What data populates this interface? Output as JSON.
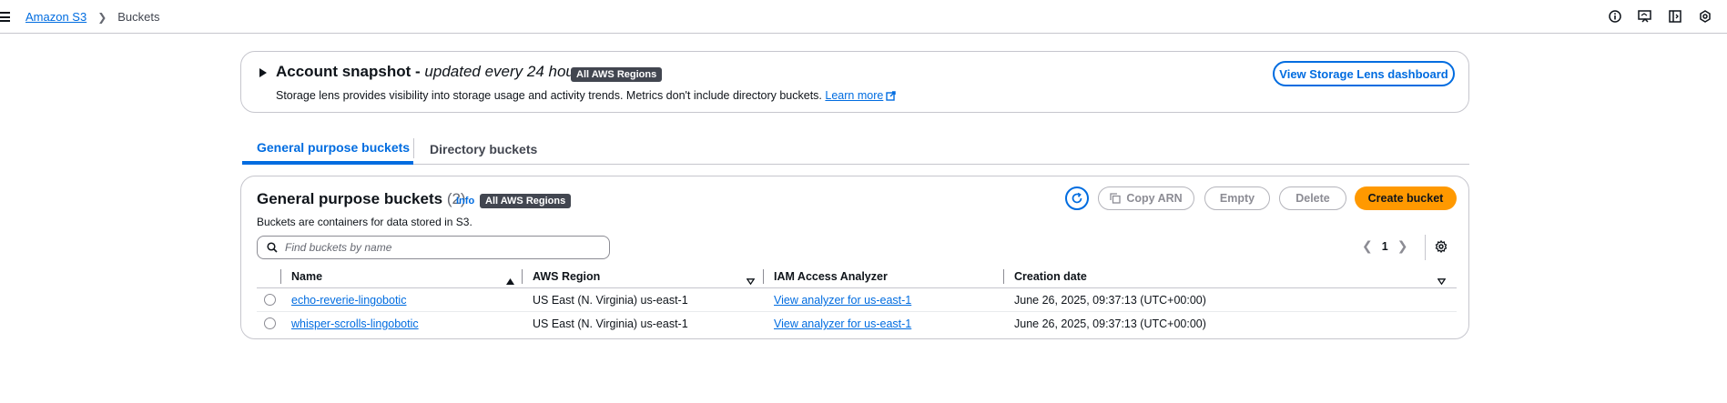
{
  "breadcrumb": {
    "root": "Amazon S3",
    "current": "Buckets"
  },
  "top_icons": [
    "info-icon",
    "feedback-icon",
    "panel-icon",
    "settings-gear-icon"
  ],
  "snapshot": {
    "title_bold": "Account snapshot - ",
    "title_italic": "updated every 24 hours",
    "badge": "All AWS Regions",
    "description": "Storage lens provides visibility into storage usage and activity trends. Metrics don't include directory buckets.",
    "learn_more": "Learn more",
    "lens_button": "View Storage Lens dashboard"
  },
  "tabs": [
    {
      "label": "General purpose buckets",
      "active": true
    },
    {
      "label": "Directory buckets",
      "active": false
    }
  ],
  "panel": {
    "title": "General purpose buckets",
    "count": "(2)",
    "info": "Info",
    "badge": "All AWS Regions",
    "description": "Buckets are containers for data stored in S3.",
    "buttons": {
      "copy_arn": "Copy ARN",
      "empty": "Empty",
      "delete": "Delete",
      "create": "Create bucket"
    },
    "search_placeholder": "Find buckets by name",
    "page": "1"
  },
  "table": {
    "columns": [
      "Name",
      "AWS Region",
      "IAM Access Analyzer",
      "Creation date"
    ],
    "rows": [
      {
        "name": "echo-reverie-lingobotic",
        "region": "US East (N. Virginia) us-east-1",
        "analyzer": "View analyzer for us-east-1",
        "created": "June 26, 2025, 09:37:13 (UTC+00:00)"
      },
      {
        "name": "whisper-scrolls-lingobotic",
        "region": "US East (N. Virginia) us-east-1",
        "analyzer": "View analyzer for us-east-1",
        "created": "June 26, 2025, 09:37:13 (UTC+00:00)"
      }
    ]
  },
  "colors": {
    "accent": "#006ce0",
    "primary_button": "#ff9900",
    "badge_bg": "#424650",
    "border": "#c6c6cd"
  }
}
